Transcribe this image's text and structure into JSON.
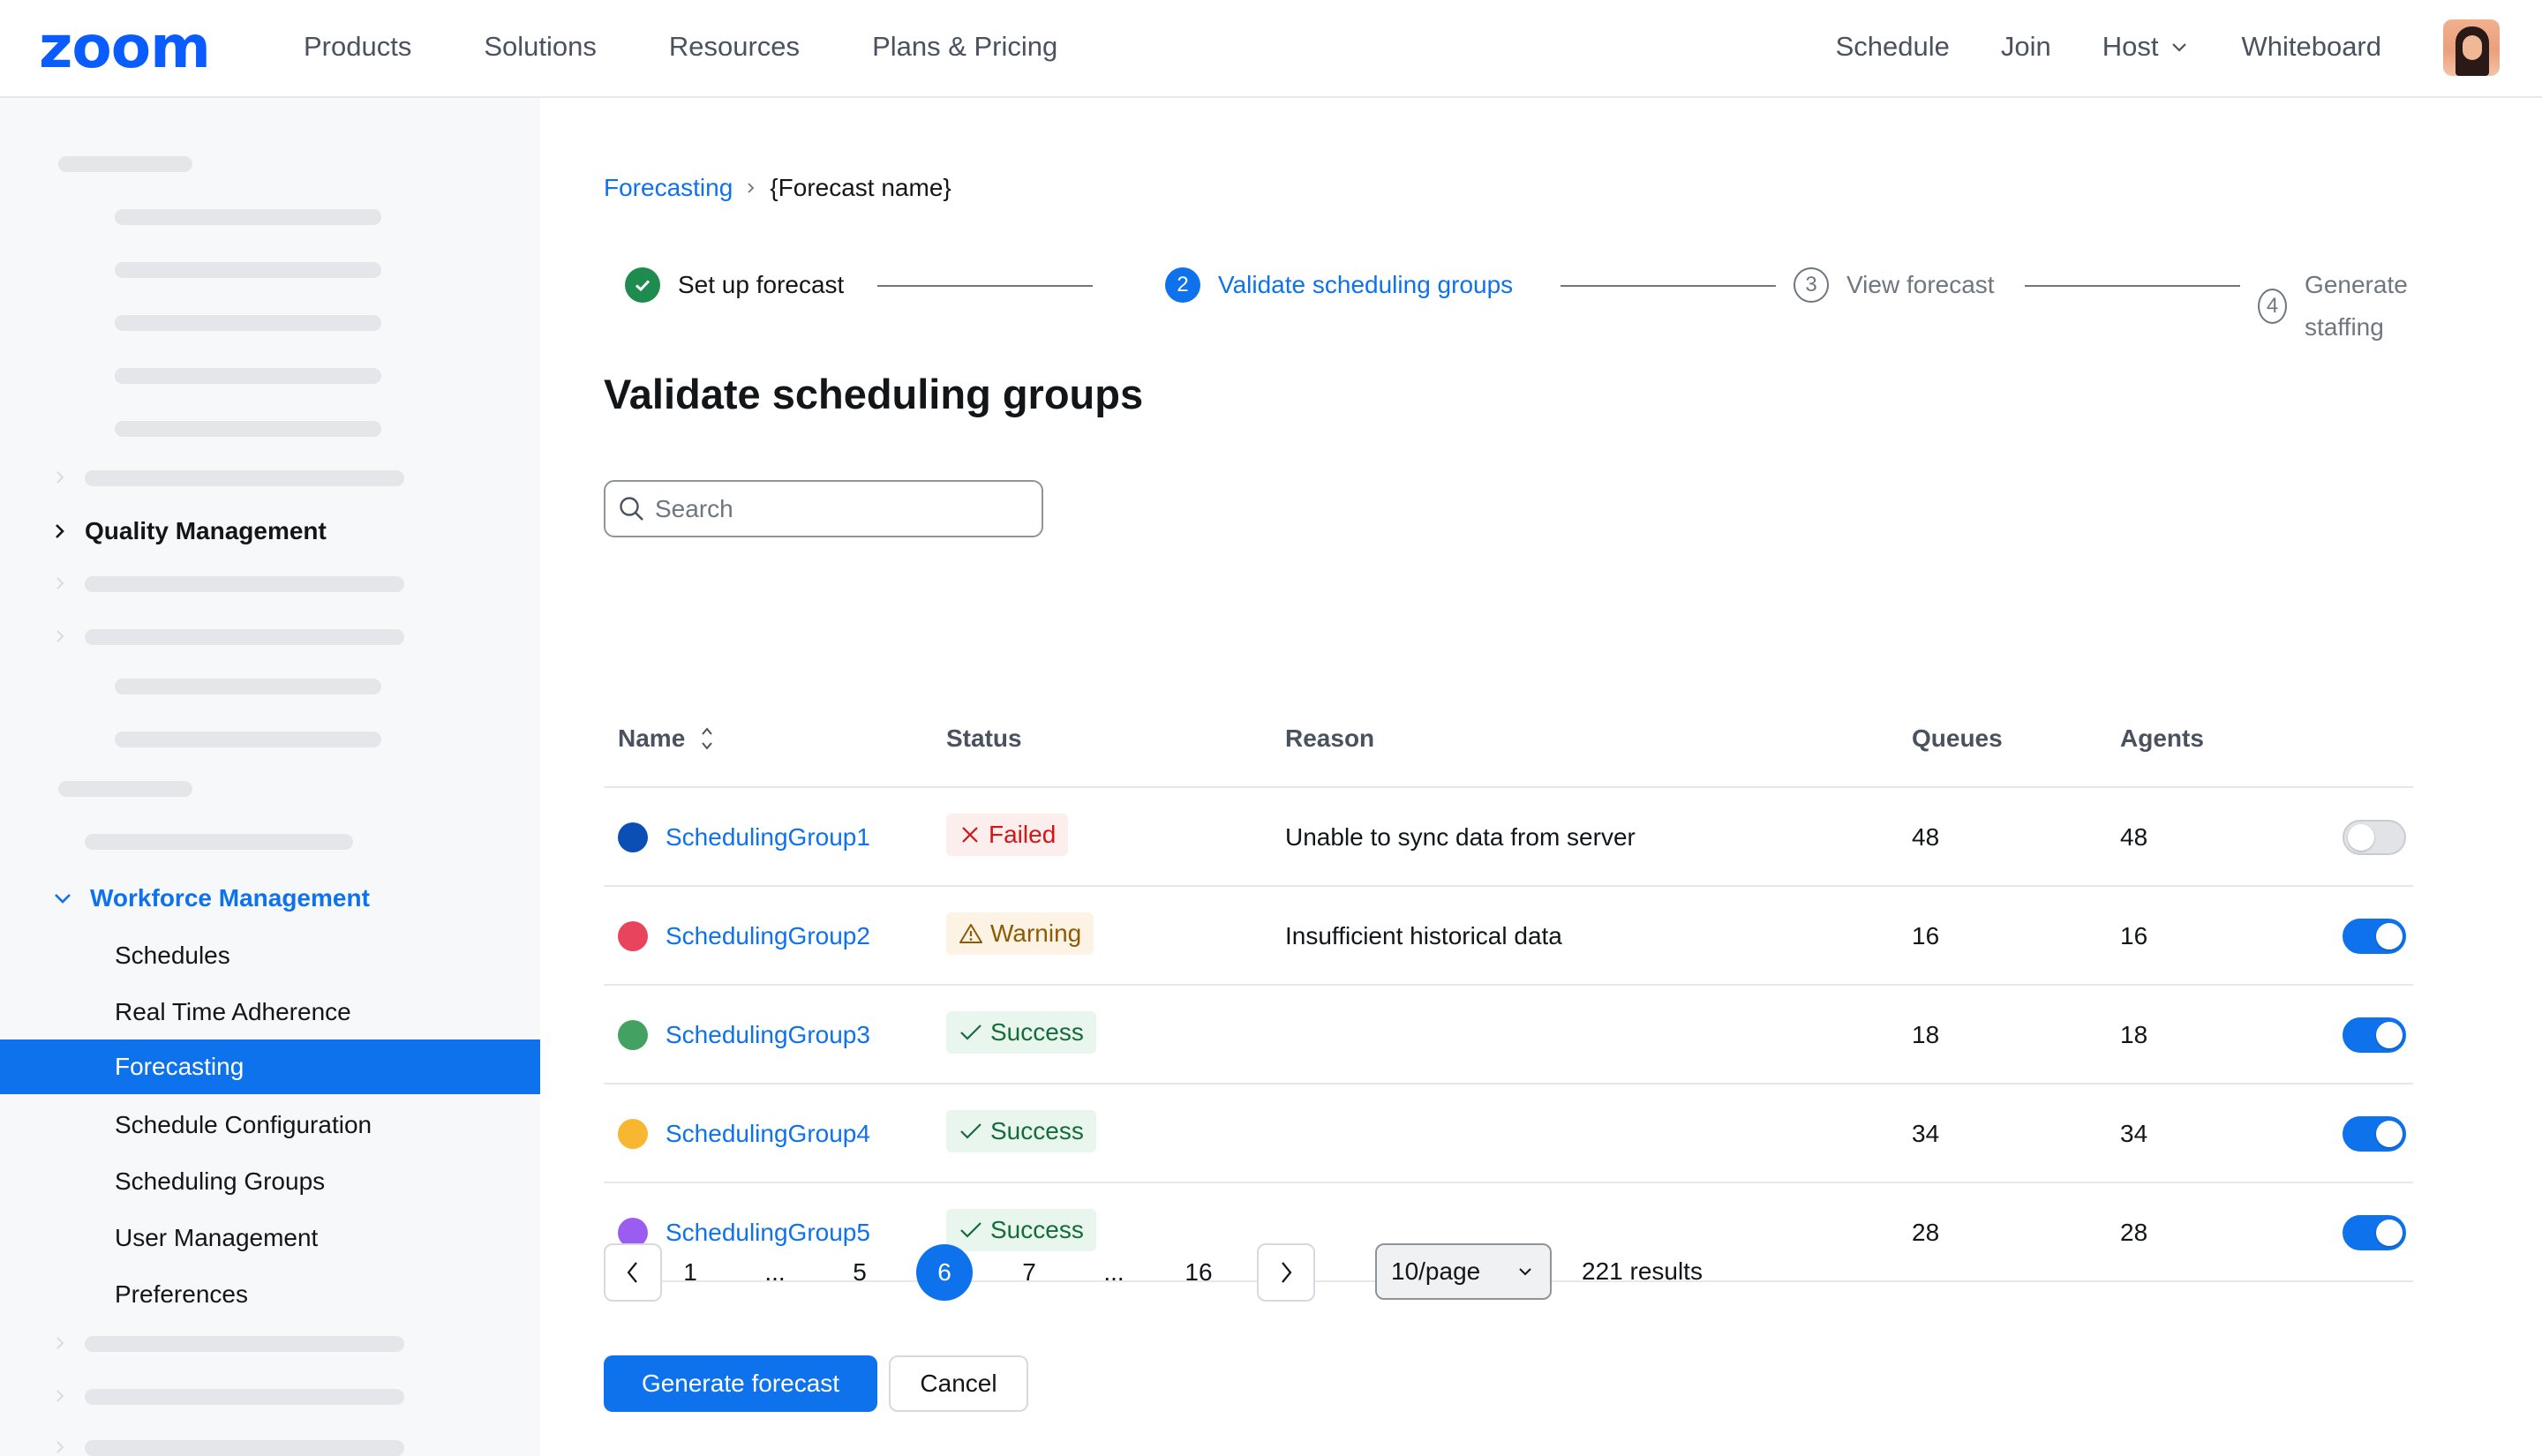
{
  "header": {
    "logo": "zoom",
    "nav_left": [
      "Products",
      "Solutions",
      "Resources",
      "Plans & Pricing"
    ],
    "nav_right": [
      "Schedule",
      "Join",
      "Host",
      "Whiteboard"
    ]
  },
  "sidebar": {
    "quality_management": "Quality Management",
    "workforce_management": "Workforce Management",
    "items": [
      "Schedules",
      "Real Time Adherence",
      "Forecasting",
      "Schedule Configuration",
      "Scheduling Groups",
      "User Management",
      "Preferences"
    ],
    "active_item": "Forecasting"
  },
  "breadcrumb": {
    "parent": "Forecasting",
    "current": "{Forecast name}"
  },
  "stepper": {
    "steps": [
      {
        "num": "",
        "label": "Set up forecast",
        "state": "done"
      },
      {
        "num": "2",
        "label": "Validate scheduling groups",
        "state": "active"
      },
      {
        "num": "3",
        "label": "View forecast",
        "state": "pending"
      },
      {
        "num": "4",
        "label": "Generate staffing",
        "state": "pending"
      }
    ]
  },
  "page_title": "Validate scheduling groups",
  "search": {
    "placeholder": "Search",
    "value": ""
  },
  "table": {
    "headers": {
      "name": "Name",
      "status": "Status",
      "reason": "Reason",
      "queues": "Queues",
      "agents": "Agents"
    },
    "rows": [
      {
        "name": "SchedulingGroup1",
        "color": "#0b4fb4",
        "status": "Failed",
        "status_type": "failed",
        "reason": "Unable to sync data from server",
        "queues": "48",
        "agents": "48",
        "enabled": false
      },
      {
        "name": "SchedulingGroup2",
        "color": "#e8445e",
        "status": "Warning",
        "status_type": "warning",
        "reason": "Insufficient historical data",
        "queues": "16",
        "agents": "16",
        "enabled": true
      },
      {
        "name": "SchedulingGroup3",
        "color": "#43a262",
        "status": "Success",
        "status_type": "success",
        "reason": "",
        "queues": "18",
        "agents": "18",
        "enabled": true
      },
      {
        "name": "SchedulingGroup4",
        "color": "#f7b731",
        "status": "Success",
        "status_type": "success",
        "reason": "",
        "queues": "34",
        "agents": "34",
        "enabled": true
      },
      {
        "name": "SchedulingGroup5",
        "color": "#9b5cf0",
        "status": "Success",
        "status_type": "success",
        "reason": "",
        "queues": "28",
        "agents": "28",
        "enabled": true
      }
    ]
  },
  "pagination": {
    "pages": [
      "1",
      "...",
      "5",
      "6",
      "7",
      "...",
      "16"
    ],
    "current": "6",
    "page_size": "10/page",
    "results": "221 results"
  },
  "actions": {
    "primary": "Generate forecast",
    "secondary": "Cancel"
  },
  "colors": {
    "accent": "#0e72ed",
    "logo": "#0b5cff",
    "failed": "#d31515",
    "warning": "#8f5a04",
    "success": "#166b3b"
  }
}
